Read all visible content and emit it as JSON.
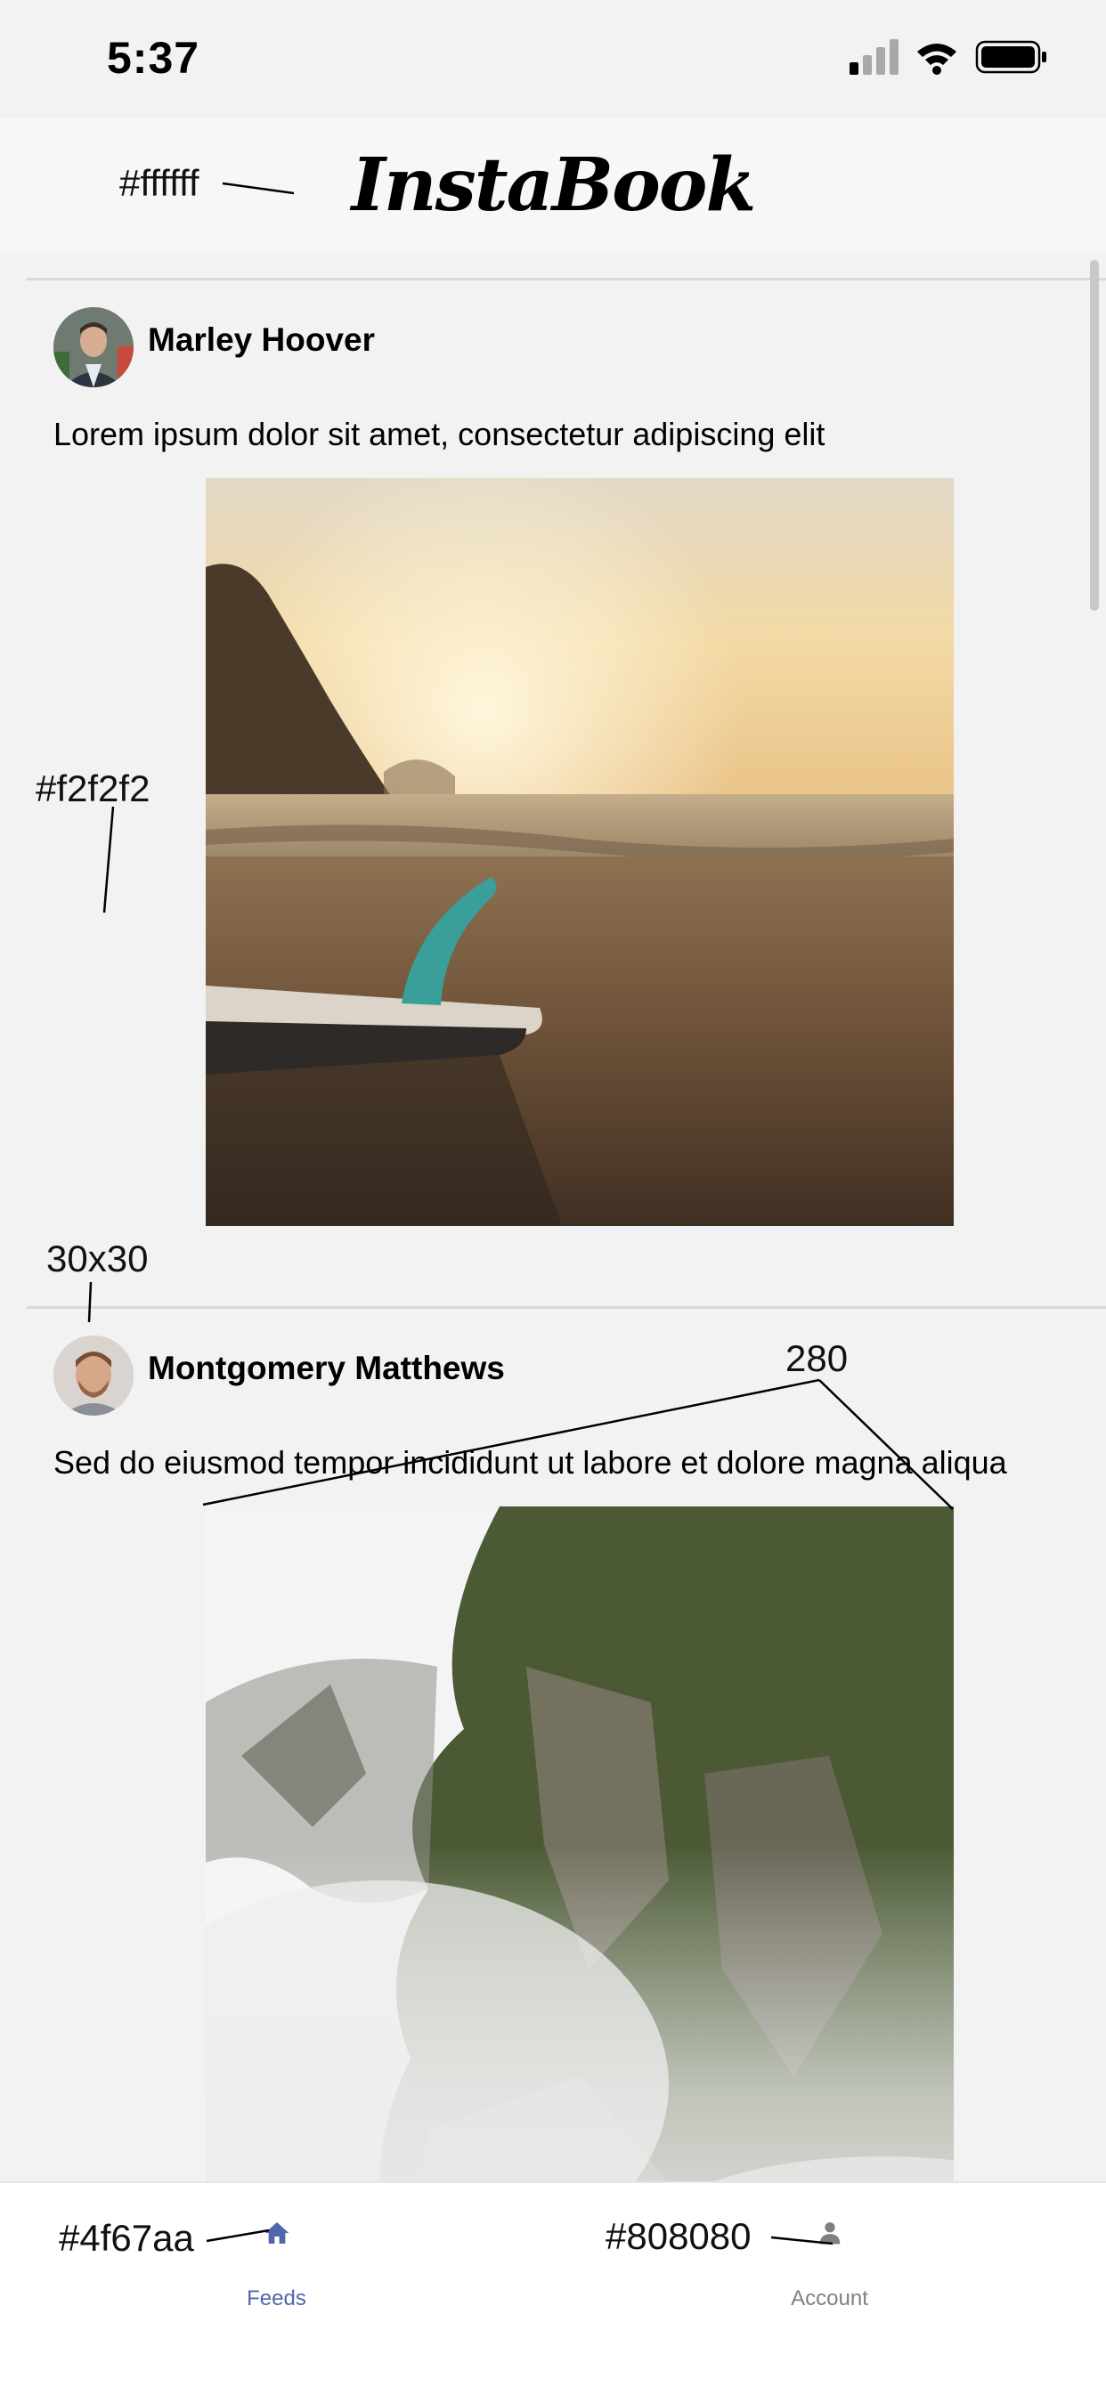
{
  "status_bar": {
    "time": "5:37"
  },
  "header": {
    "logo": "InstaBook"
  },
  "posts": [
    {
      "author": "Marley Hoover",
      "caption": "Lorem ipsum dolor sit amet, consectetur adipiscing elit"
    },
    {
      "author": "Montgomery Matthews",
      "caption": "Sed do eiusmod tempor incididunt ut labore et dolore magna aliqua"
    }
  ],
  "tabs": [
    {
      "label": "Feeds",
      "icon": "home-icon",
      "color": "#4f67aa",
      "active": true
    },
    {
      "label": "Account",
      "icon": "person-icon",
      "color": "#808080",
      "active": false
    }
  ],
  "annotations": {
    "header_bg": "#ffffff",
    "feed_bg": "#f2f2f2",
    "avatar_size": "30x30",
    "image_size": "280",
    "active_tab_color": "#4f67aa",
    "inactive_tab_color": "#808080"
  }
}
